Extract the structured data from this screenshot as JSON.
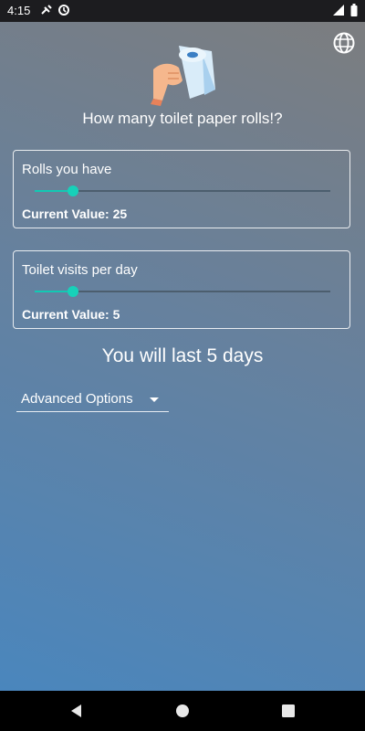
{
  "status_bar": {
    "time": "4:15",
    "icons": [
      "notification-icon",
      "data-saver-icon",
      "wifi-icon",
      "battery-icon"
    ]
  },
  "app": {
    "header_icon": "globe-icon",
    "hero_icon": "hand-holding-toilet-paper-icon",
    "question": "How many toilet paper rolls!?",
    "accent_color": "#17d1b9",
    "rolls": {
      "label": "Rolls you have",
      "value_text": "Current Value: 25",
      "fraction": 0.13
    },
    "visits": {
      "label": "Toilet visits per day",
      "value_text": "Current Value: 5",
      "fraction": 0.13
    },
    "result": "You will last 5 days",
    "advanced": {
      "label": "Advanced Options",
      "icon": "caret-down-icon"
    }
  },
  "nav_bar": {
    "buttons": [
      "back-icon",
      "home-icon",
      "recents-icon"
    ]
  }
}
